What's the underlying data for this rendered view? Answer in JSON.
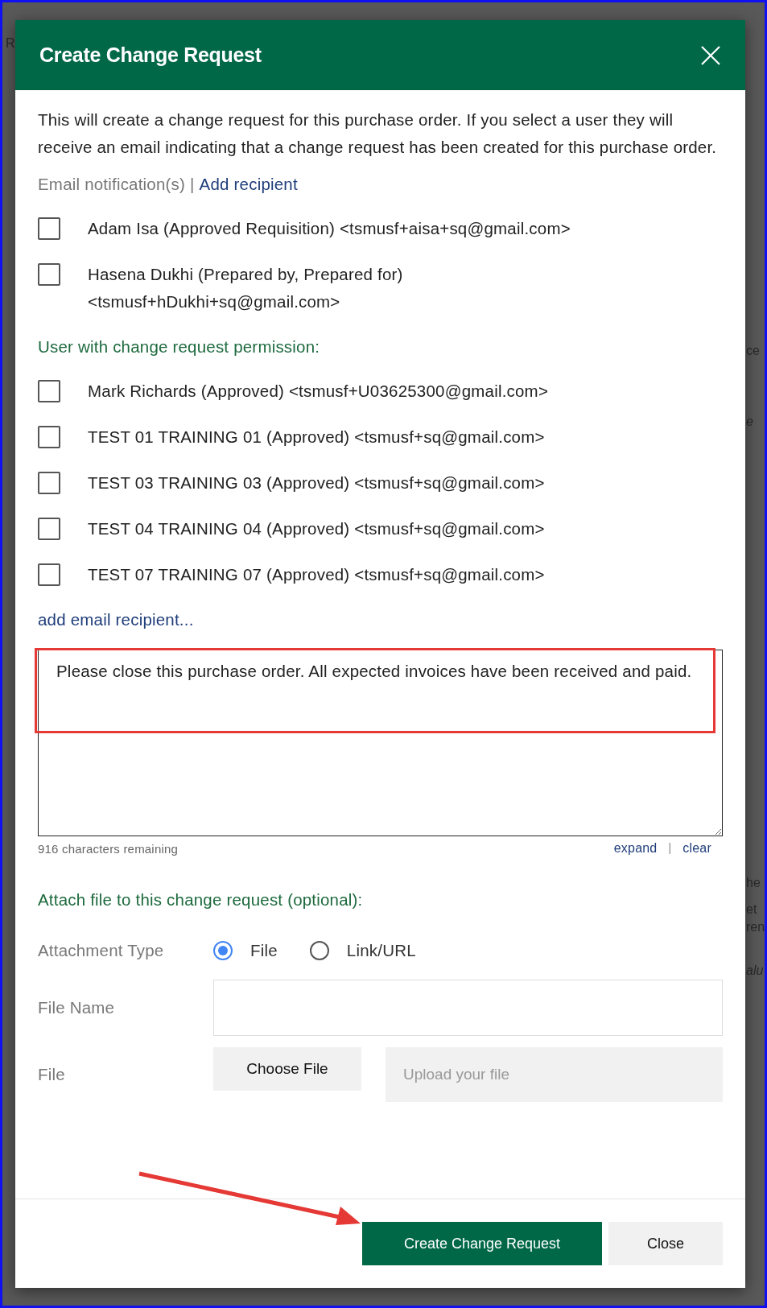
{
  "background_fragments": [
    {
      "text": "R",
      "italic": false
    },
    {
      "text": "ce",
      "italic": false
    },
    {
      "text": "e",
      "italic": true
    },
    {
      "text": "he",
      "italic": false
    },
    {
      "text": "et",
      "italic": false
    },
    {
      "text": "ren",
      "italic": false
    },
    {
      "text": "alu",
      "italic": true
    }
  ],
  "dialog": {
    "title": "Create Change Request",
    "intro": "This will create a change request for this purchase order. If you select a user they will receive an email indicating that a change request has been created for this purchase order.",
    "notification_label": "Email notification(s)",
    "separator": "|",
    "add_recipient": "Add recipient",
    "recipients": [
      {
        "lines": [
          "Adam Isa (Approved Requisition) <tsmusf+aisa+sq@gmail.com>"
        ],
        "checked": false
      },
      {
        "lines": [
          "Hasena Dukhi (Prepared by, Prepared for)",
          "<tsmusf+hDukhi+sq@gmail.com>"
        ],
        "checked": false
      }
    ],
    "permission_label": "User with change request permission:",
    "permission_users": [
      {
        "lines": [
          "Mark Richards (Approved) <tsmusf+U03625300@gmail.com>"
        ],
        "checked": false
      },
      {
        "lines": [
          "TEST 01 TRAINING 01 (Approved) <tsmusf+sq@gmail.com>"
        ],
        "checked": false
      },
      {
        "lines": [
          "TEST 03 TRAINING 03 (Approved) <tsmusf+sq@gmail.com>"
        ],
        "checked": false
      },
      {
        "lines": [
          "TEST 04 TRAINING 04 (Approved) <tsmusf+sq@gmail.com>"
        ],
        "checked": false
      },
      {
        "lines": [
          "TEST 07 TRAINING 07 (Approved) <tsmusf+sq@gmail.com>"
        ],
        "checked": false
      }
    ],
    "add_email_link": "add email recipient...",
    "message": {
      "value": "Please close this purchase order. All expected invoices have been received and paid.",
      "remaining": "916 characters remaining",
      "expand": "expand",
      "divider": "|",
      "clear": "clear"
    },
    "attach_heading": "Attach file to this change request (optional):",
    "attachment_type_label": "Attachment Type",
    "attachment_types": [
      {
        "label": "File",
        "selected": true
      },
      {
        "label": "Link/URL",
        "selected": false
      }
    ],
    "file_name_label": "File Name",
    "file_label": "File",
    "choose_file": "Choose File",
    "upload_placeholder": "Upload your file",
    "buttons": [
      {
        "label": "Create Change Request",
        "kind": "primary"
      },
      {
        "label": "Close",
        "kind": "secondary"
      }
    ]
  }
}
